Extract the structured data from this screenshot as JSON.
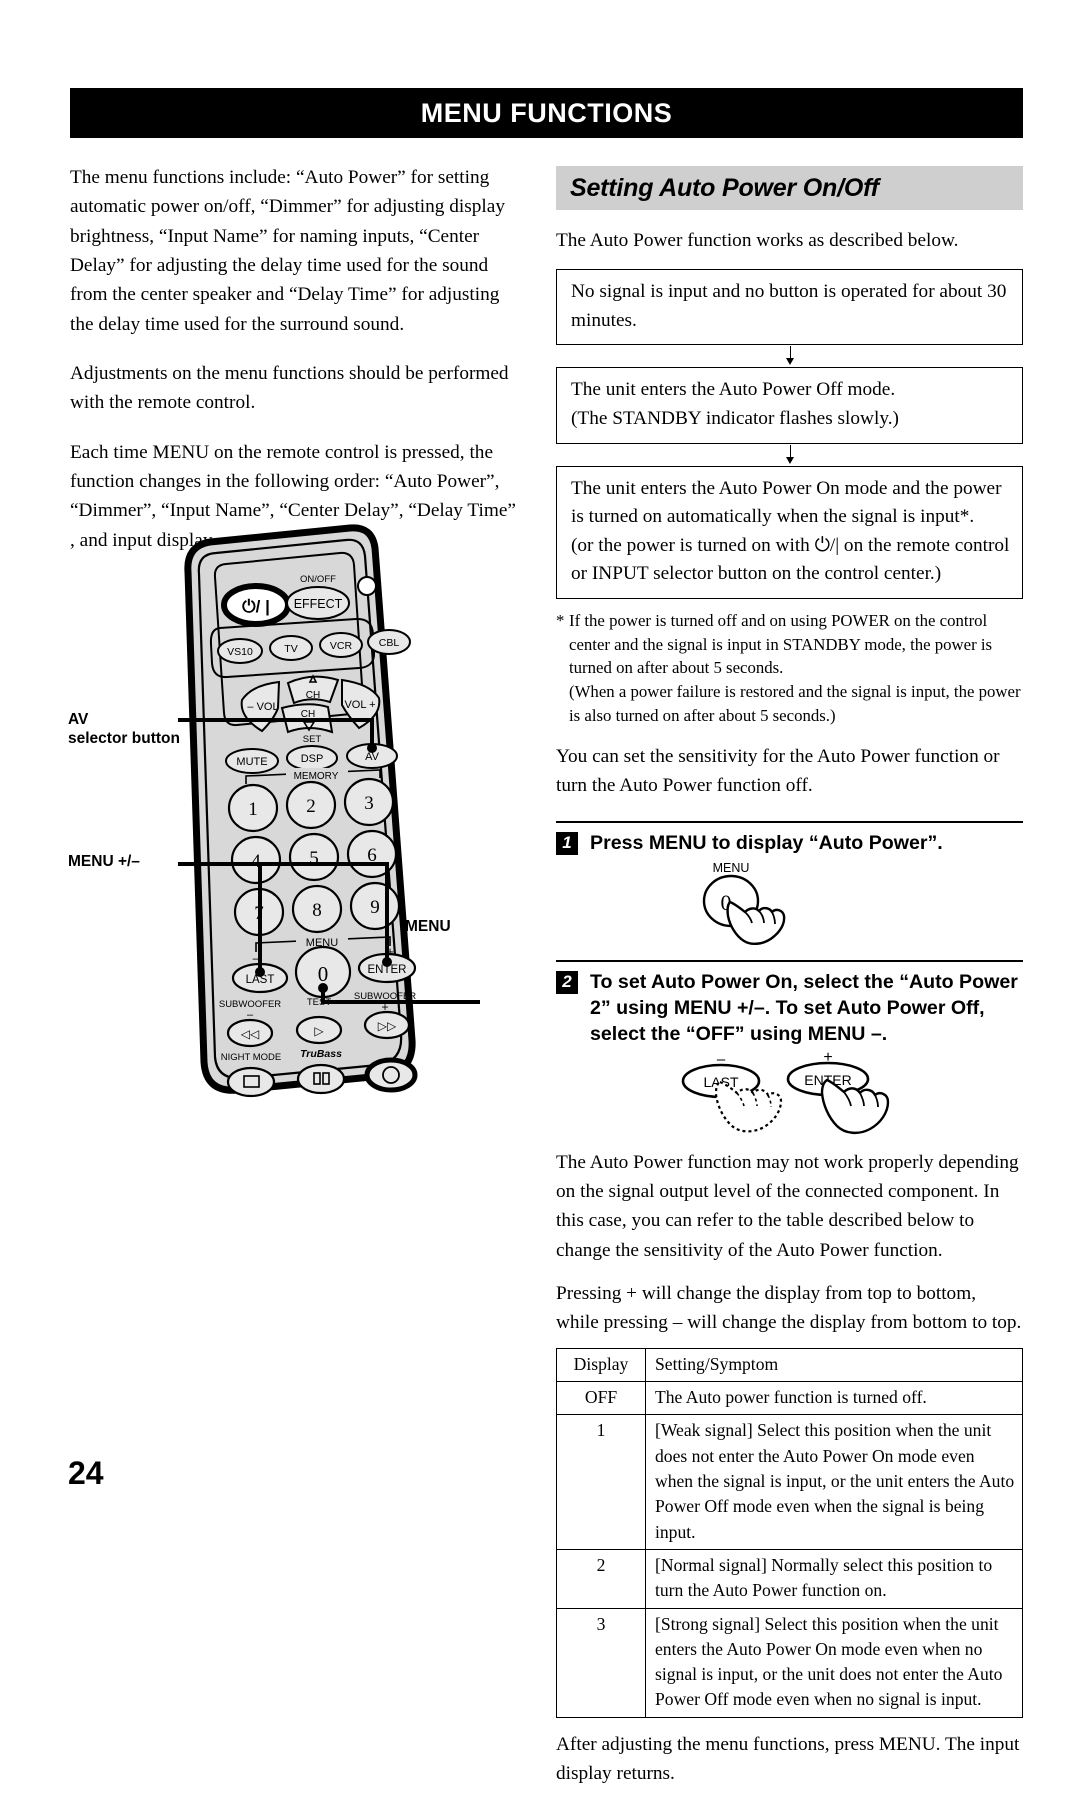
{
  "page": {
    "number": "24",
    "header_title": "MENU FUNCTIONS"
  },
  "left_column": {
    "paragraphs": [
      "The menu functions include: “Auto Power” for setting automatic power on/off, “Dimmer” for adjusting display brightness, “Input Name” for naming inputs, “Center Delay” for adjusting the delay time used for the sound from the center speaker and “Delay Time” for adjusting the delay time used for the surround sound.",
      "Adjustments on the menu functions should be performed with the remote control.",
      "Each time MENU on the remote control is pressed, the function changes in the following order: “Auto Power”, “Dimmer”, “Input Name”, “Center Delay”, “Delay Time” , and input display."
    ]
  },
  "remote": {
    "callouts": {
      "av_selector": "AV\nselector button",
      "menu_plus_minus": "MENU +/–",
      "menu": "MENU"
    },
    "buttons": {
      "power": "⏻/ |",
      "effect_label": "ON/OFF",
      "effect": "EFFECT",
      "source": [
        "VS10",
        "TV",
        "VCR",
        "CBL"
      ],
      "vol_minus": "– VOL",
      "vol_plus": "VOL +",
      "ch_up": "CH",
      "ch_down": "CH",
      "set_label": "SET",
      "mute": "MUTE",
      "dsp": "DSP",
      "av": "AV",
      "memory_label": "MEMORY",
      "numbers": [
        "1",
        "2",
        "3",
        "4",
        "5",
        "6",
        "7",
        "8",
        "9"
      ],
      "menu_label": "MENU",
      "menu_minus": "–",
      "menu_plus": "+",
      "last": "LAST",
      "zero": "0",
      "enter": "ENTER",
      "subwoofer_minus_label": "SUBWOOFER",
      "subwoofer_plus_label": "SUBWOOFER",
      "test_label": "TEST",
      "sub_minus_sign": "–",
      "sub_plus_sign": "+",
      "night_mode_label": "NIGHT MODE",
      "trubass_label": "TruBass"
    }
  },
  "right_column": {
    "section_heading": "Setting Auto Power On/Off",
    "intro": "The Auto Power function works as described below.",
    "flow": [
      "No signal is input and no button is operated for about 30 minutes.",
      "The unit enters the Auto Power Off mode.\n(The STANDBY indicator flashes slowly.)",
      "The unit enters the Auto Power On mode and the power is turned on automatically when the signal is input*.\n(or the power is turned on with ⏻/| on the remote control or INPUT selector button on the control center.)"
    ],
    "footnote": {
      "marker": "*",
      "lines": [
        "If the power is turned off and on using POWER on the control center and the signal is input in STANDBY mode, the power is turned on after about 5 seconds.",
        "(When a power failure is restored and the signal is input, the power is also turned on after about 5 seconds.)"
      ]
    },
    "sensitivity_intro": "You can set the sensitivity for the Auto Power function or turn the Auto Power function off.",
    "steps": [
      {
        "number": "1",
        "text": "Press MENU to display “Auto Power”.",
        "illustration": {
          "button_label": "MENU",
          "button_face": "0"
        }
      },
      {
        "number": "2",
        "text": "To set Auto Power On, select the “Auto Power 2” using MENU +/–. To set Auto Power Off, select the “OFF” using MENU –.",
        "illustration": {
          "left_sign": "–",
          "left_button": "LAST",
          "right_sign": "+",
          "right_button": "ENTER"
        }
      }
    ],
    "after_steps": [
      "The Auto Power function may not work properly depending on the signal output level of the connected component. In this case, you can refer to the table described below to change the sensitivity of the Auto Power function.",
      "Pressing + will change the display from top to bottom, while pressing – will change the display from bottom to top."
    ],
    "table": {
      "headers": [
        "Display",
        "Setting/Symptom"
      ],
      "rows": [
        [
          "OFF",
          "The Auto power function is turned off."
        ],
        [
          "1",
          "[Weak signal] Select this position when the unit does not enter the Auto Power On mode even when the signal is input, or the unit enters the Auto Power Off mode even when the signal is being input."
        ],
        [
          "2",
          "[Normal signal] Normally select this position to turn the Auto Power function on."
        ],
        [
          "3",
          "[Strong signal] Select this position when the unit enters the Auto Power On mode even when no signal is input, or the unit does not enter the Auto Power Off mode even when no signal is input."
        ]
      ]
    },
    "closing": "After adjusting the menu functions, press MENU. The input display returns."
  },
  "colors": {
    "header_bg": "#000000",
    "section_bg": "#cfcfcf",
    "remote_body": "#d8d8d8",
    "text": "#000000"
  }
}
